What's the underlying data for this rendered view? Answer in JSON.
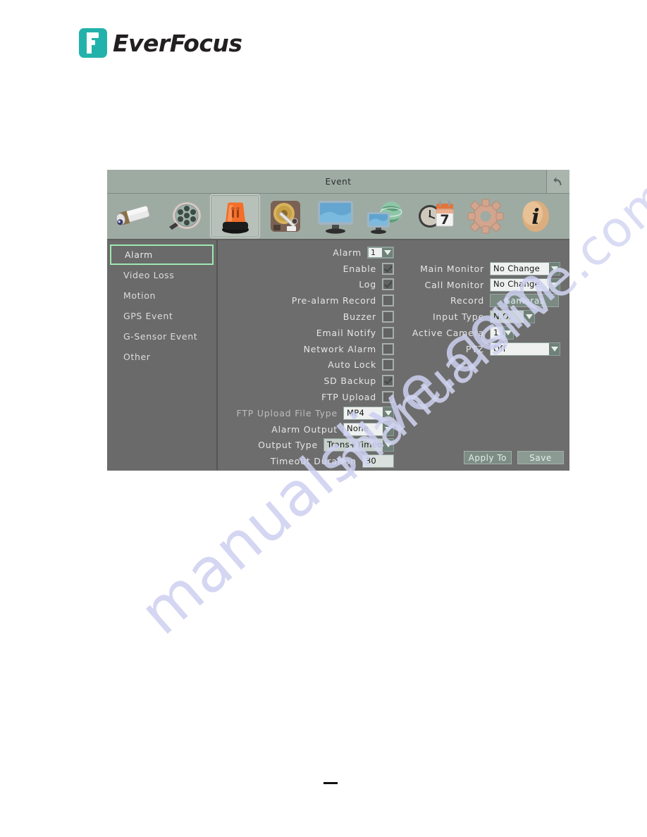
{
  "brand": {
    "name": "EverFocus",
    "logo_color": "#23b2ab"
  },
  "window": {
    "title": "Event",
    "back_icon": "back-arrow-icon"
  },
  "toolbar": {
    "items": [
      {
        "name": "camera-icon",
        "label": "Camera"
      },
      {
        "name": "film-reel-icon",
        "label": "Record"
      },
      {
        "name": "alarm-light-icon",
        "label": "Event",
        "selected": true
      },
      {
        "name": "hard-disk-icon",
        "label": "Disk"
      },
      {
        "name": "monitor-icon",
        "label": "Display"
      },
      {
        "name": "network-globe-icon",
        "label": "Network"
      },
      {
        "name": "clock-calendar-icon",
        "label": "Schedule"
      },
      {
        "name": "gear-icon",
        "label": "System"
      },
      {
        "name": "info-icon",
        "label": "Information"
      }
    ]
  },
  "sidebar": {
    "items": [
      {
        "label": "Alarm",
        "active": true
      },
      {
        "label": "Video Loss",
        "active": false
      },
      {
        "label": "Motion",
        "active": false
      },
      {
        "label": "GPS Event",
        "active": false
      },
      {
        "label": "G-Sensor Event",
        "active": false
      },
      {
        "label": "Other",
        "active": false
      }
    ]
  },
  "form": {
    "left": {
      "alarm": {
        "label": "Alarm",
        "value": "1"
      },
      "checkboxes": [
        {
          "label": "Enable",
          "checked": true
        },
        {
          "label": "Log",
          "checked": true
        },
        {
          "label": "Pre-alarm Record",
          "checked": false
        },
        {
          "label": "Buzzer",
          "checked": false
        },
        {
          "label": "Email Notify",
          "checked": false
        },
        {
          "label": "Network Alarm",
          "checked": false
        },
        {
          "label": "Auto Lock",
          "checked": false
        },
        {
          "label": "SD Backup",
          "checked": true
        },
        {
          "label": "FTP Upload",
          "checked": false
        }
      ],
      "ftp_upload_file_type": {
        "label": "FTP Upload File Type",
        "value": "MP4"
      },
      "alarm_output": {
        "label": "Alarm Output",
        "value": "None"
      },
      "output_type": {
        "label": "Output Type",
        "value": "Trans+Timeout"
      },
      "timeout_duration": {
        "label": "Timeout Duration",
        "value": "30"
      }
    },
    "right": {
      "main_monitor": {
        "label": "Main Monitor",
        "value": "No Change"
      },
      "call_monitor": {
        "label": "Call Monitor",
        "value": "No Change"
      },
      "record": {
        "label": "Record",
        "button_label": "Cameras"
      },
      "input_type": {
        "label": "Input Type",
        "value": "N.O."
      },
      "active_camera": {
        "label": "Active Camera",
        "value": "1"
      },
      "ptz": {
        "label": "PTZ",
        "value": "Off"
      }
    }
  },
  "actions": {
    "apply_to": "Apply To",
    "save": "Save"
  },
  "watermark": {
    "line1": "manualslive.com",
    "line2": "manualslive.com"
  },
  "colors": {
    "titlebar": "#9eaba3",
    "panel": "#6d6d6d",
    "sidebar": "#6a6a6a",
    "active_border": "#9fe8b0",
    "field_bg": "#eef1f0"
  }
}
